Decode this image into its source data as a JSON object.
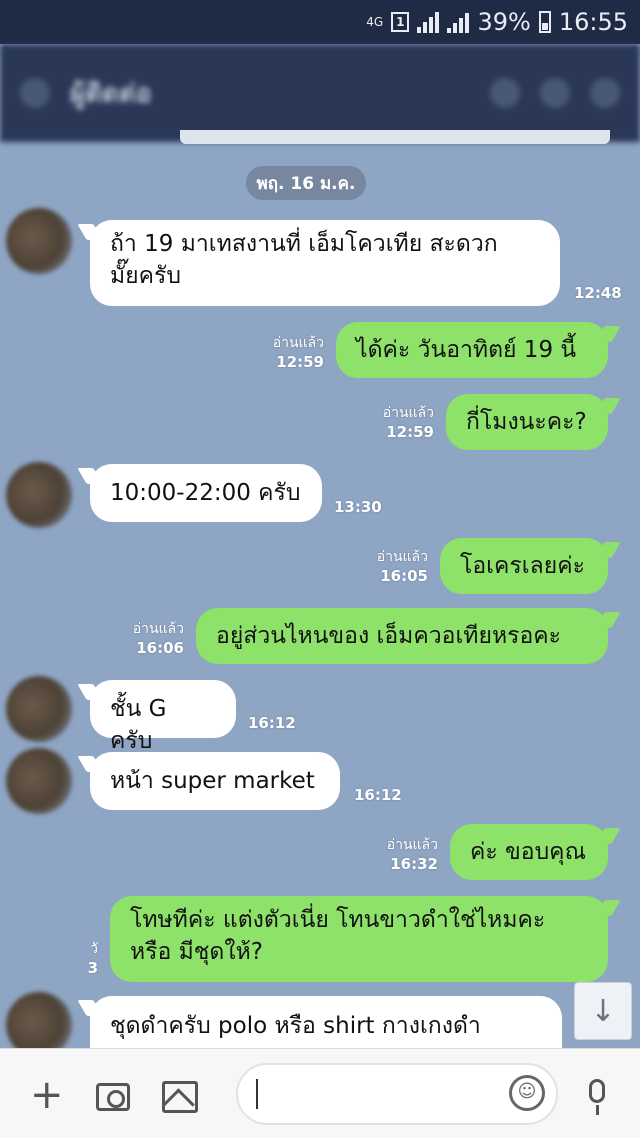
{
  "status_bar": {
    "network": "4G",
    "sim": "1",
    "battery": "39%",
    "time": "16:55"
  },
  "header": {
    "title": "ผู้ติดต่อ"
  },
  "chat": {
    "date": "พฤ. 16 ม.ค.",
    "read_label": "อ่านแล้ว",
    "messages": [
      {
        "side": "in",
        "text_line1": "ถ้า 19 มาเทสงานที่ เอ็มโควเทีย สะดวก",
        "text_line2": "มั๊ยครับ",
        "time": "12:48"
      },
      {
        "side": "out",
        "text": "ได้ค่ะ วันอาทิตย์ 19 นี้",
        "read": "อ่านแล้ว",
        "time": "12:59"
      },
      {
        "side": "out",
        "text": "กี่โมงนะคะ?",
        "read": "อ่านแล้ว",
        "time": "12:59"
      },
      {
        "side": "in",
        "text": "10:00-22:00 ครับ",
        "time": "13:30"
      },
      {
        "side": "out",
        "text": "โอเครเลยค่ะ",
        "read": "อ่านแล้ว",
        "time": "16:05"
      },
      {
        "side": "out",
        "text": "อยู่ส่วนไหนของ เอ็มควอเทียหรอคะ",
        "read": "อ่านแล้ว",
        "time": "16:06"
      },
      {
        "side": "in",
        "text": "ชั้น G ครับ",
        "time": "16:12"
      },
      {
        "side": "in",
        "text": "หน้า super market",
        "time": "16:12"
      },
      {
        "side": "out",
        "text": "ค่ะ ขอบคุณ",
        "read": "อ่านแล้ว",
        "time": "16:32"
      },
      {
        "side": "out",
        "text_line1": "โทษทีค่ะ แต่งตัวเนี่ย โทนขาวดำใช่ไหมคะ",
        "text_line2": "หรือ มีชุดให้?",
        "read": "วั",
        "time": "3"
      },
      {
        "side": "in",
        "text": "ชุดดำครับ polo หรือ shirt กางเกงดำ"
      }
    ]
  },
  "scroll_down": {
    "icon": "arrow-down-icon",
    "glyph": "↓"
  },
  "input_bar": {
    "placeholder": "",
    "emoji_glyph": "☺",
    "plus_glyph": "+"
  },
  "colors": {
    "incoming_bubble": "#ffffff",
    "outgoing_bubble": "#8ee26a",
    "chat_background": "#8ea5c4",
    "status_bar": "#1f2a44"
  }
}
